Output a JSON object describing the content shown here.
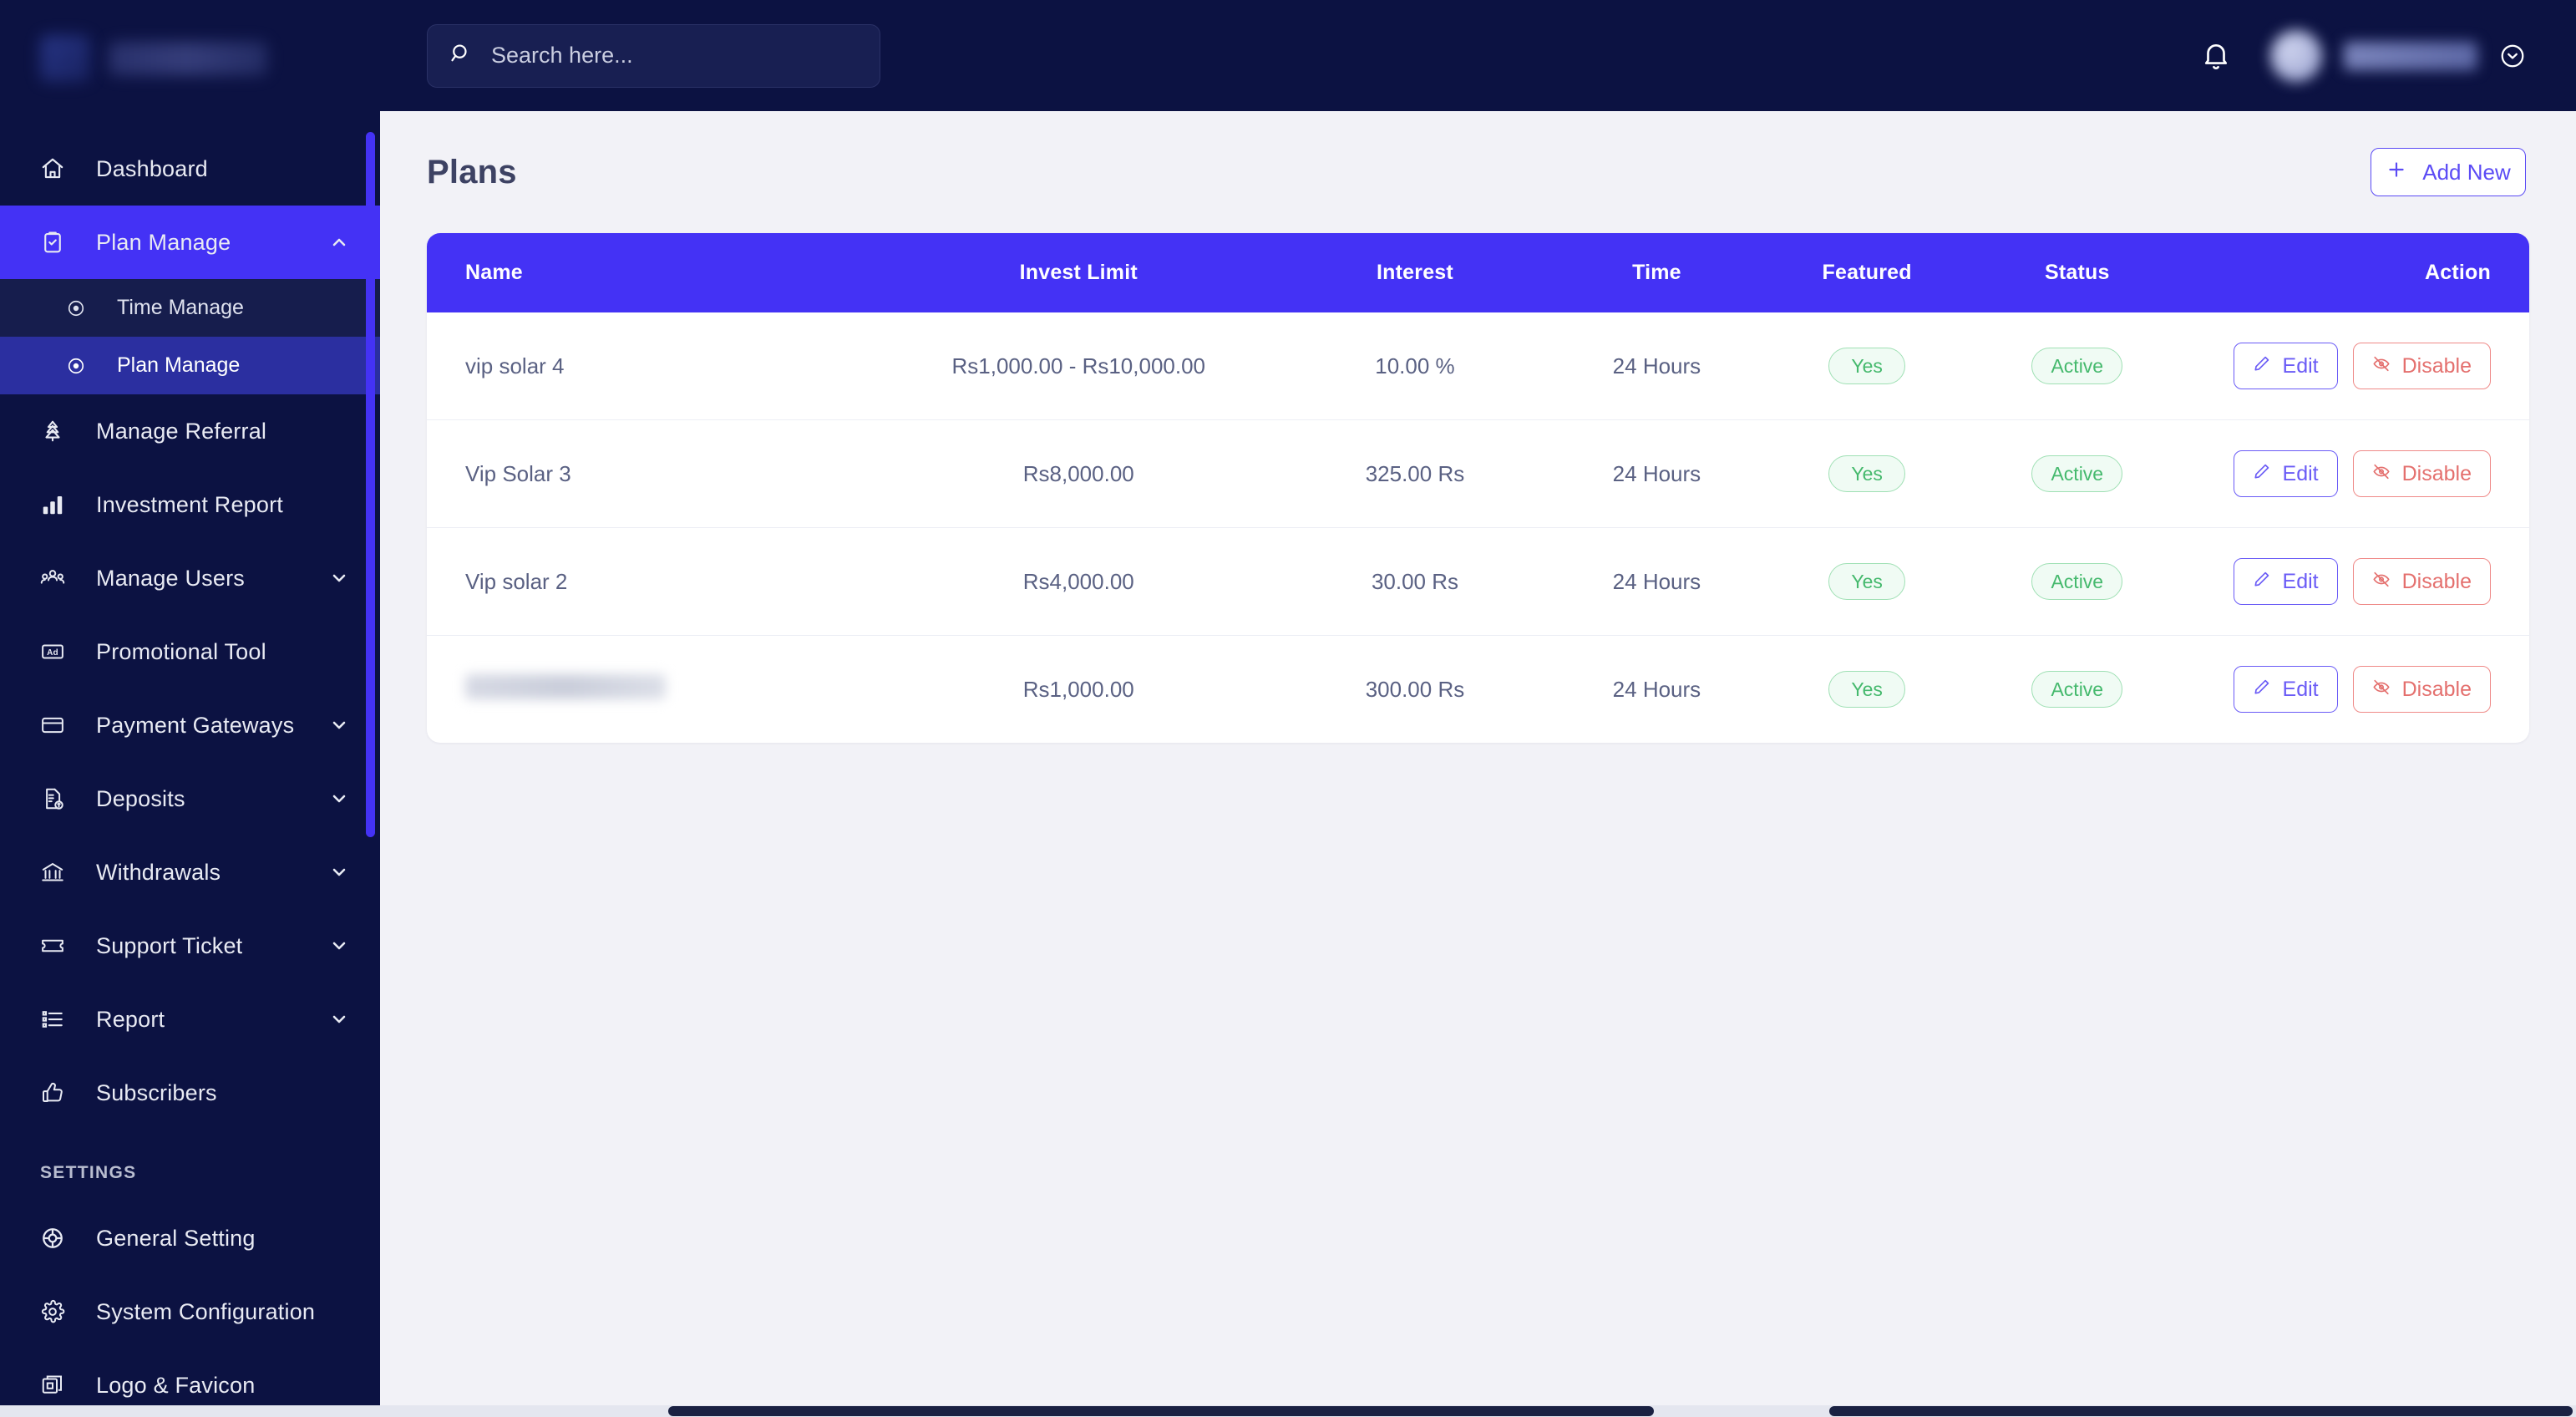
{
  "brand": {
    "accent": "#4432f5",
    "sidebar_bg": "#0c1242",
    "page_bg": "#f2f2f7"
  },
  "sidebar": {
    "items": [
      {
        "label": "Dashboard",
        "icon": "home-icon",
        "has_chevron": false,
        "active": false
      },
      {
        "label": "Plan Manage",
        "icon": "clipboard-check-icon",
        "has_chevron": true,
        "chevron": "up",
        "active": true
      },
      {
        "label": "Manage Referral",
        "icon": "referral-tree-icon",
        "has_chevron": false,
        "active": false
      },
      {
        "label": "Investment Report",
        "icon": "bar-chart-icon",
        "has_chevron": false,
        "active": false
      },
      {
        "label": "Manage Users",
        "icon": "users-group-icon",
        "has_chevron": true,
        "chevron": "down",
        "active": false
      },
      {
        "label": "Promotional Tool",
        "icon": "ad-icon",
        "has_chevron": false,
        "active": false
      },
      {
        "label": "Payment Gateways",
        "icon": "credit-card-icon",
        "has_chevron": true,
        "chevron": "down",
        "active": false
      },
      {
        "label": "Deposits",
        "icon": "file-dollar-icon",
        "has_chevron": true,
        "chevron": "down",
        "active": false
      },
      {
        "label": "Withdrawals",
        "icon": "bank-icon",
        "has_chevron": true,
        "chevron": "down",
        "active": false
      },
      {
        "label": "Support Ticket",
        "icon": "ticket-icon",
        "has_chevron": true,
        "chevron": "down",
        "active": false
      },
      {
        "label": "Report",
        "icon": "list-icon",
        "has_chevron": true,
        "chevron": "down",
        "active": false
      },
      {
        "label": "Subscribers",
        "icon": "thumbs-up-icon",
        "has_chevron": false,
        "active": false
      }
    ],
    "submenu": [
      {
        "label": "Time Manage",
        "icon": "dot-circle-icon",
        "active": false
      },
      {
        "label": "Plan Manage",
        "icon": "dot-circle-icon",
        "active": true
      }
    ],
    "section_label": "SETTINGS",
    "settings_items": [
      {
        "label": "General Setting",
        "icon": "target-icon"
      },
      {
        "label": "System Configuration",
        "icon": "gear-icon"
      },
      {
        "label": "Logo & Favicon",
        "icon": "layers-icon"
      }
    ]
  },
  "topbar": {
    "search_placeholder": "Search here...",
    "search_value": "",
    "notification_icon": "bell-icon",
    "profile_caret_icon": "chevron-down-circle-icon"
  },
  "page": {
    "title": "Plans",
    "add_new_label": "Add New",
    "add_new_icon": "plus-icon"
  },
  "table": {
    "columns": [
      "Name",
      "Invest Limit",
      "Interest",
      "Time",
      "Featured",
      "Status",
      "Action"
    ],
    "rows": [
      {
        "name": "vip solar 4",
        "name_redacted": false,
        "invest_limit": "Rs1,000.00 - Rs10,000.00",
        "interest": "10.00 %",
        "time": "24 Hours",
        "featured": "Yes",
        "status": "Active",
        "edit_label": "Edit",
        "disable_label": "Disable"
      },
      {
        "name": "Vip Solar 3",
        "name_redacted": false,
        "invest_limit": "Rs8,000.00",
        "interest": "325.00 Rs",
        "time": "24 Hours",
        "featured": "Yes",
        "status": "Active",
        "edit_label": "Edit",
        "disable_label": "Disable"
      },
      {
        "name": "Vip solar 2",
        "name_redacted": false,
        "invest_limit": "Rs4,000.00",
        "interest": "30.00 Rs",
        "time": "24 Hours",
        "featured": "Yes",
        "status": "Active",
        "edit_label": "Edit",
        "disable_label": "Disable"
      },
      {
        "name": "",
        "name_redacted": true,
        "invest_limit": "Rs1,000.00",
        "interest": "300.00 Rs",
        "time": "24 Hours",
        "featured": "Yes",
        "status": "Active",
        "edit_label": "Edit",
        "disable_label": "Disable"
      }
    ]
  }
}
